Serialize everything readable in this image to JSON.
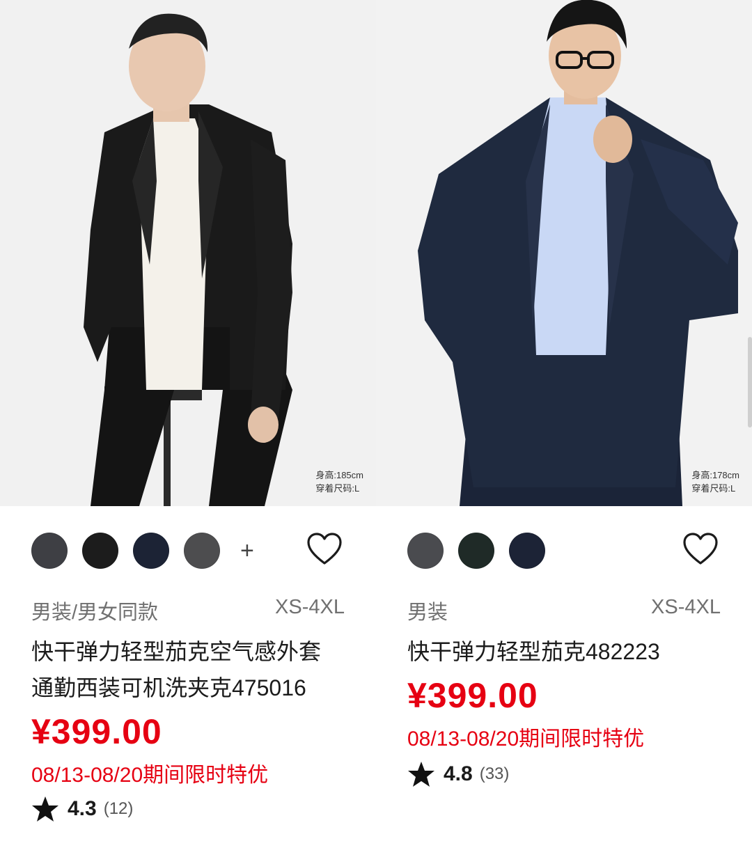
{
  "products": [
    {
      "model_height": "身高:185cm",
      "model_size": "穿着尺码:L",
      "swatches": [
        "#3e3f44",
        "#1c1c1c",
        "#1c2335",
        "#4d4d4f"
      ],
      "more_colors": "+",
      "category": "男装/男女同款",
      "sizes": "XS-4XL",
      "title_line1": "快干弹力轻型茄克空气感外套",
      "title_line2": "通勤西装可机洗夹克475016",
      "price": "¥399.00",
      "promo": "08/13-08/20期间限时特优",
      "rating": "4.3",
      "review_count": "(12)"
    },
    {
      "model_height": "身高:178cm",
      "model_size": "穿着尺码:L",
      "swatches": [
        "#4a4b4f",
        "#1f2a27",
        "#1c2336"
      ],
      "category": "男装",
      "sizes": "XS-4XL",
      "title_line1": "快干弹力轻型茄克482223",
      "price": "¥399.00",
      "promo": "08/13-08/20期间限时特优",
      "rating": "4.8",
      "review_count": "(33)"
    }
  ],
  "icons": {
    "favorite": "heart-outline-icon",
    "star": "star-filled-icon"
  },
  "colors": {
    "price_red": "#e60012",
    "text_gray": "#707070"
  }
}
